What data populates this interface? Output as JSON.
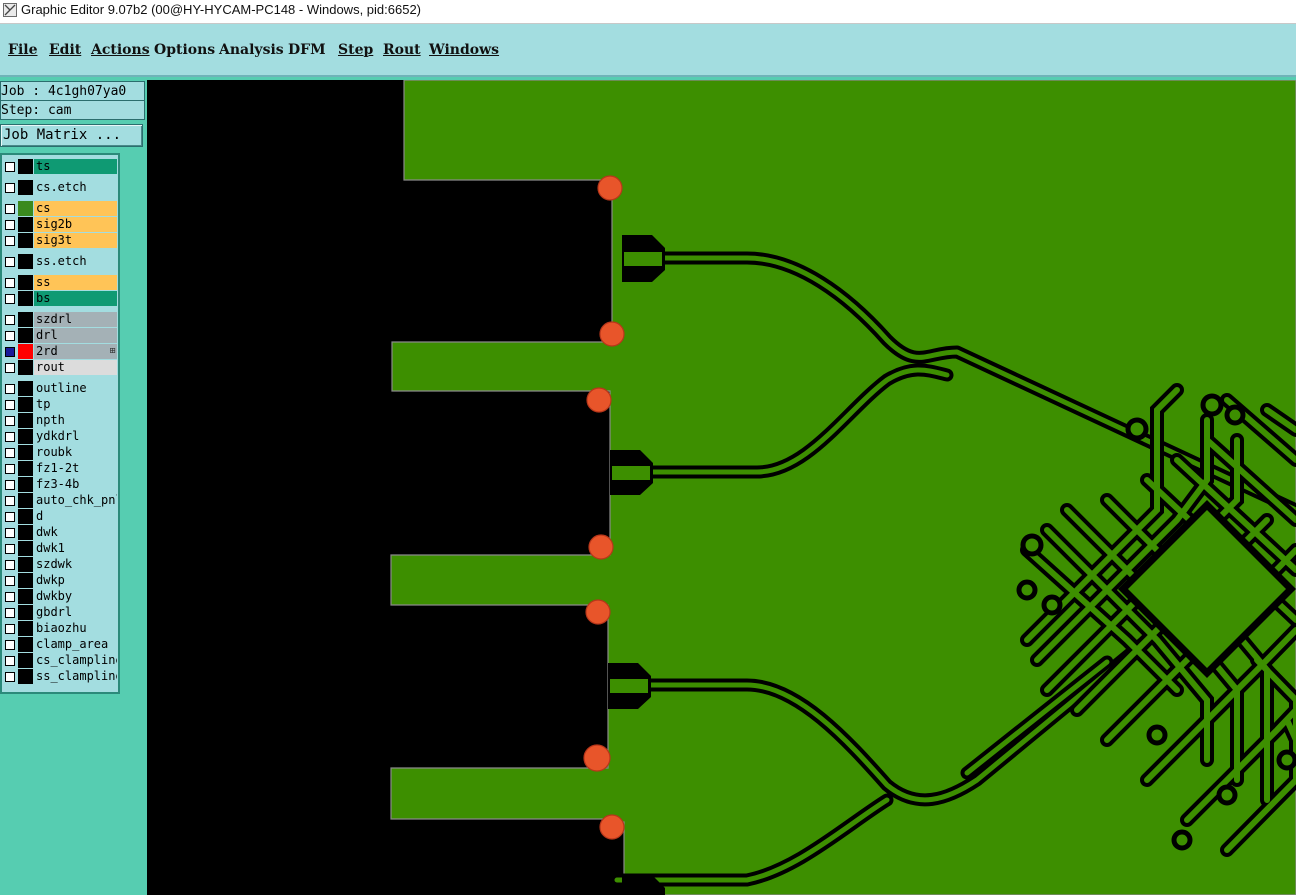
{
  "window": {
    "title": "Graphic Editor 9.07b2 (00@HY-HYCAM-PC148 - Windows, pid:6652)"
  },
  "menu": [
    {
      "label": "File"
    },
    {
      "label": "Edit"
    },
    {
      "label": "Actions"
    },
    {
      "label": "Options"
    },
    {
      "label": "Analysis"
    },
    {
      "label": "DFM"
    },
    {
      "label": "Step"
    },
    {
      "label": "Rout"
    },
    {
      "label": "Windows"
    }
  ],
  "job": {
    "job_line": "Job : 4c1gh07ya0",
    "step_line": "Step: cam"
  },
  "job_matrix_button": "Job Matrix ...",
  "layers": [
    {
      "name": "ts",
      "checked": false,
      "type_color": "#0f9a73",
      "swatch": "#000000"
    },
    {
      "name": "cs.etch",
      "checked": false,
      "type_color": "#a3dde0",
      "swatch": "#000000"
    },
    {
      "name": "cs",
      "checked": false,
      "type_color": "#ffc457",
      "swatch": "#3a8a1e"
    },
    {
      "name": "sig2b",
      "checked": false,
      "type_color": "#ffc457",
      "swatch": "#000000"
    },
    {
      "name": "sig3t",
      "checked": false,
      "type_color": "#ffc457",
      "swatch": "#000000"
    },
    {
      "name": "ss.etch",
      "checked": false,
      "type_color": "#a3dde0",
      "swatch": "#000000"
    },
    {
      "name": "ss",
      "checked": false,
      "type_color": "#ffc457",
      "swatch": "#000000"
    },
    {
      "name": "bs",
      "checked": false,
      "type_color": "#0f9a73",
      "swatch": "#000000"
    },
    {
      "name": "szdrl",
      "checked": false,
      "type_color": "#a4b1b6",
      "swatch": "#000000"
    },
    {
      "name": "drl",
      "checked": false,
      "type_color": "#a4b1b6",
      "swatch": "#000000"
    },
    {
      "name": "2rd",
      "checked": true,
      "type_color": "#a4b1b6",
      "swatch": "#ff0000",
      "marker": "⊞"
    },
    {
      "name": "rout",
      "checked": false,
      "type_color": "#dcdcdc",
      "swatch": "#000000"
    },
    {
      "name": "outline",
      "checked": false,
      "type_color": "#a3dde0",
      "swatch": "#000000"
    },
    {
      "name": "tp",
      "checked": false,
      "type_color": "#a3dde0",
      "swatch": "#000000"
    },
    {
      "name": "npth",
      "checked": false,
      "type_color": "#a3dde0",
      "swatch": "#000000"
    },
    {
      "name": "ydkdrl",
      "checked": false,
      "type_color": "#a3dde0",
      "swatch": "#000000"
    },
    {
      "name": "roubk",
      "checked": false,
      "type_color": "#a3dde0",
      "swatch": "#000000"
    },
    {
      "name": "fz1-2t",
      "checked": false,
      "type_color": "#a3dde0",
      "swatch": "#000000"
    },
    {
      "name": "fz3-4b",
      "checked": false,
      "type_color": "#a3dde0",
      "swatch": "#000000"
    },
    {
      "name": "auto_chk_pnl",
      "checked": false,
      "type_color": "#a3dde0",
      "swatch": "#000000"
    },
    {
      "name": "d",
      "checked": false,
      "type_color": "#a3dde0",
      "swatch": "#000000"
    },
    {
      "name": "dwk",
      "checked": false,
      "type_color": "#a3dde0",
      "swatch": "#000000"
    },
    {
      "name": "dwk1",
      "checked": false,
      "type_color": "#a3dde0",
      "swatch": "#000000"
    },
    {
      "name": "szdwk",
      "checked": false,
      "type_color": "#a3dde0",
      "swatch": "#000000"
    },
    {
      "name": "dwkp",
      "checked": false,
      "type_color": "#a3dde0",
      "swatch": "#000000"
    },
    {
      "name": "dwkby",
      "checked": false,
      "type_color": "#a3dde0",
      "swatch": "#000000"
    },
    {
      "name": "gbdrl",
      "checked": false,
      "type_color": "#a3dde0",
      "swatch": "#000000"
    },
    {
      "name": "biaozhu",
      "checked": false,
      "type_color": "#a3dde0",
      "swatch": "#000000"
    },
    {
      "name": "clamp_area",
      "checked": false,
      "type_color": "#a3dde0",
      "swatch": "#000000"
    },
    {
      "name": "cs_clampline",
      "checked": false,
      "type_color": "#a3dde0",
      "swatch": "#000000"
    },
    {
      "name": "ss_clampline",
      "checked": false,
      "type_color": "#a3dde0",
      "swatch": "#000000"
    }
  ],
  "colors": {
    "copper": "#3d8f00",
    "background": "#000000",
    "drill": "#e8552a",
    "menubar": "#a3dde0",
    "panel": "#56cdb1"
  }
}
